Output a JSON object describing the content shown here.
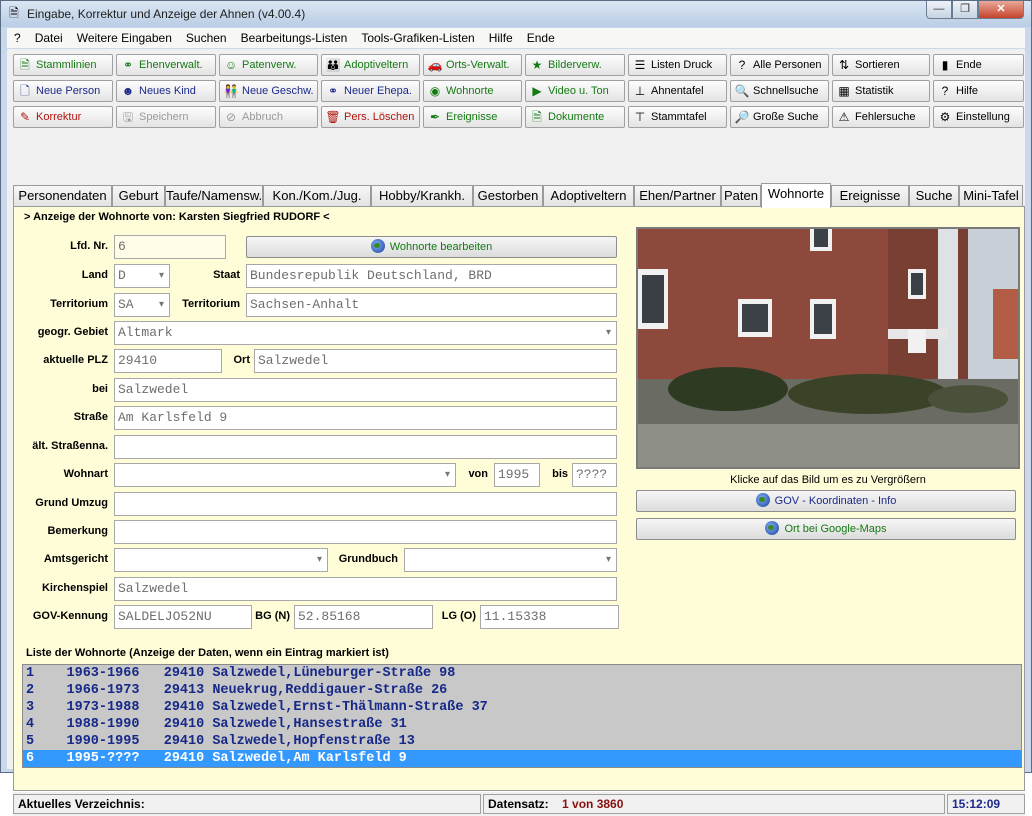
{
  "window": {
    "title": "Eingabe, Korrektur und Anzeige der Ahnen (v4.00.4)",
    "min": "—",
    "max": "❐",
    "close": "✕"
  },
  "menu": [
    "?",
    "Datei",
    "Weitere Eingaben",
    "Suchen",
    "Bearbeitungs-Listen",
    "Tools-Grafiken-Listen",
    "Hilfe",
    "Ende"
  ],
  "toolbar": {
    "row1": [
      {
        "label": "Stammlinien",
        "icon": "stammlinien-icon",
        "glyph": "🗎",
        "color": "green"
      },
      {
        "label": "Ehenverwalt.",
        "icon": "rings-icon",
        "glyph": "⚭",
        "color": "green"
      },
      {
        "label": "Patenverw.",
        "icon": "smiley-icon",
        "glyph": "☺",
        "color": "green"
      },
      {
        "label": "Adoptiveltern",
        "icon": "people-icon",
        "glyph": "👪",
        "color": "green"
      },
      {
        "label": "Orts-Verwalt.",
        "icon": "car-icon",
        "glyph": "🚗",
        "color": "green"
      },
      {
        "label": "Bilderverw.",
        "icon": "person-star-icon",
        "glyph": "★",
        "color": "green"
      },
      {
        "label": "Listen Druck",
        "icon": "list-icon",
        "glyph": "☰",
        "color": "black"
      },
      {
        "label": "Alle Personen",
        "icon": "question-people-icon",
        "glyph": "?",
        "color": "black"
      },
      {
        "label": "Sortieren",
        "icon": "sort-icon",
        "glyph": "⇅",
        "color": "black"
      },
      {
        "label": "Ende",
        "icon": "exit-door-icon",
        "glyph": "▮",
        "color": "black"
      }
    ],
    "row2": [
      {
        "label": "Neue Person",
        "icon": "new-page-icon",
        "glyph": "🗋",
        "color": "blue"
      },
      {
        "label": "Neues Kind",
        "icon": "child-icon",
        "glyph": "☻",
        "color": "blue"
      },
      {
        "label": "Neue Geschw.",
        "icon": "siblings-icon",
        "glyph": "👫",
        "color": "blue"
      },
      {
        "label": "Neuer Ehepa.",
        "icon": "couple-icon",
        "glyph": "⚭",
        "color": "blue"
      },
      {
        "label": "Wohnorte",
        "icon": "globe-icon",
        "glyph": "◉",
        "color": "green"
      },
      {
        "label": "Video u. Ton",
        "icon": "video-icon",
        "glyph": "▶",
        "color": "green"
      },
      {
        "label": "Ahnentafel",
        "icon": "tree-icon",
        "glyph": "⊥",
        "color": "black"
      },
      {
        "label": "Schnellsuche",
        "icon": "quicksearch-icon",
        "glyph": "🔍",
        "color": "black"
      },
      {
        "label": "Statistik",
        "icon": "stats-icon",
        "glyph": "▦",
        "color": "black"
      },
      {
        "label": "Hilfe",
        "icon": "help-icon",
        "glyph": "?",
        "color": "black"
      }
    ],
    "row3": [
      {
        "label": "Korrektur",
        "icon": "edit-icon",
        "glyph": "✎",
        "color": "red"
      },
      {
        "label": "Speichern",
        "icon": "save-icon",
        "glyph": "🖫",
        "color": "gray"
      },
      {
        "label": "Abbruch",
        "icon": "cancel-icon",
        "glyph": "⊘",
        "color": "gray"
      },
      {
        "label": "Pers. Löschen",
        "icon": "trash-icon",
        "glyph": "🗑",
        "color": "red"
      },
      {
        "label": "Ereignisse",
        "icon": "event-pen-icon",
        "glyph": "✒",
        "color": "green"
      },
      {
        "label": "Dokumente",
        "icon": "document-icon",
        "glyph": "🗎",
        "color": "green"
      },
      {
        "label": "Stammtafel",
        "icon": "chart-tree-icon",
        "glyph": "⊤",
        "color": "black"
      },
      {
        "label": "Große Suche",
        "icon": "bigsearch-icon",
        "glyph": "🔎",
        "color": "black"
      },
      {
        "label": "Fehlersuche",
        "icon": "errorsearch-icon",
        "glyph": "⚠",
        "color": "black"
      },
      {
        "label": "Einstellung",
        "icon": "settings-icon",
        "glyph": "⚙",
        "color": "black"
      }
    ]
  },
  "tabs": [
    "Personendaten",
    "Geburt",
    "Taufe/Namensw.",
    "Kon./Kom./Jug.",
    "Hobby/Krankh.",
    "Gestorben",
    "Adoptiveltern",
    "Ehen/Partner",
    "Paten",
    "Wohnorte",
    "Ereignisse",
    "Suche",
    "Mini-Tafel"
  ],
  "active_tab": "Wohnorte",
  "form": {
    "header": "> Anzeige der Wohnorte von:   Karsten Siegfried RUDORF <",
    "labels": {
      "lfd": "Lfd. Nr.",
      "land": "Land",
      "staat": "Staat",
      "territorium1": "Territorium",
      "territorium2": "Territorium",
      "gebiet": "geogr. Gebiet",
      "plz": "aktuelle PLZ",
      "ort": "Ort",
      "bei": "bei",
      "strasse": "Straße",
      "altstrasse": "ält. Straßenna.",
      "wohnart": "Wohnart",
      "von": "von",
      "bis": "bis",
      "umzug": "Grund Umzug",
      "bemerkung": "Bemerkung",
      "amtsgericht": "Amtsgericht",
      "grundbuch": "Grundbuch",
      "kirchenspiel": "Kirchenspiel",
      "gov": "GOV-Kennung",
      "bg": "BG (N)",
      "lg": "LG (O)"
    },
    "values": {
      "lfd": "6",
      "land": "D",
      "staat": "Bundesrepublik Deutschland, BRD",
      "territorium_code": "SA",
      "territorium": "Sachsen-Anhalt",
      "gebiet": "Altmark",
      "plz": "29410",
      "ort": "Salzwedel",
      "bei": "Salzwedel",
      "strasse": "Am Karlsfeld 9",
      "altstrasse": "",
      "wohnart": "",
      "von": "1995",
      "bis": "????",
      "umzug": "",
      "bemerkung": "",
      "amtsgericht": "",
      "grundbuch": "",
      "kirchenspiel": "Salzwedel",
      "gov": "SALDELJO52NU",
      "bg": "52.85168",
      "lg": "11.15338"
    },
    "edit_button": "Wohnorte bearbeiten"
  },
  "photo": {
    "caption": "Klicke auf das Bild um es zu Vergrößern"
  },
  "gov_button": "GOV - Koordinaten - Info",
  "maps_button": "Ort bei Google-Maps",
  "list": {
    "label": "Liste der Wohnorte (Anzeige der Daten, wenn ein Eintrag markiert ist)",
    "rows": [
      "1    1963-1966   29410 Salzwedel,Lüneburger-Straße 98",
      "2    1966-1973   29413 Neuekrug,Reddigauer-Straße 26",
      "3    1973-1988   29410 Salzwedel,Ernst-Thälmann-Straße 37",
      "4    1988-1990   29410 Salzwedel,Hansestraße 31",
      "5    1990-1995   29410 Salzwedel,Hopfenstraße 13",
      "6    1995-????   29410 Salzwedel,Am Karlsfeld 9"
    ],
    "selected_index": 5
  },
  "status": {
    "verzeichnis_label": "Aktuelles Verzeichnis:",
    "datensatz_label": "Datensatz:",
    "datensatz_value": "1 von 3860",
    "time": "15:12:09"
  },
  "colors": {
    "panel": "#fffdd7",
    "selection": "#3399ff",
    "list_text": "#162888",
    "green_text": "#157a14"
  }
}
